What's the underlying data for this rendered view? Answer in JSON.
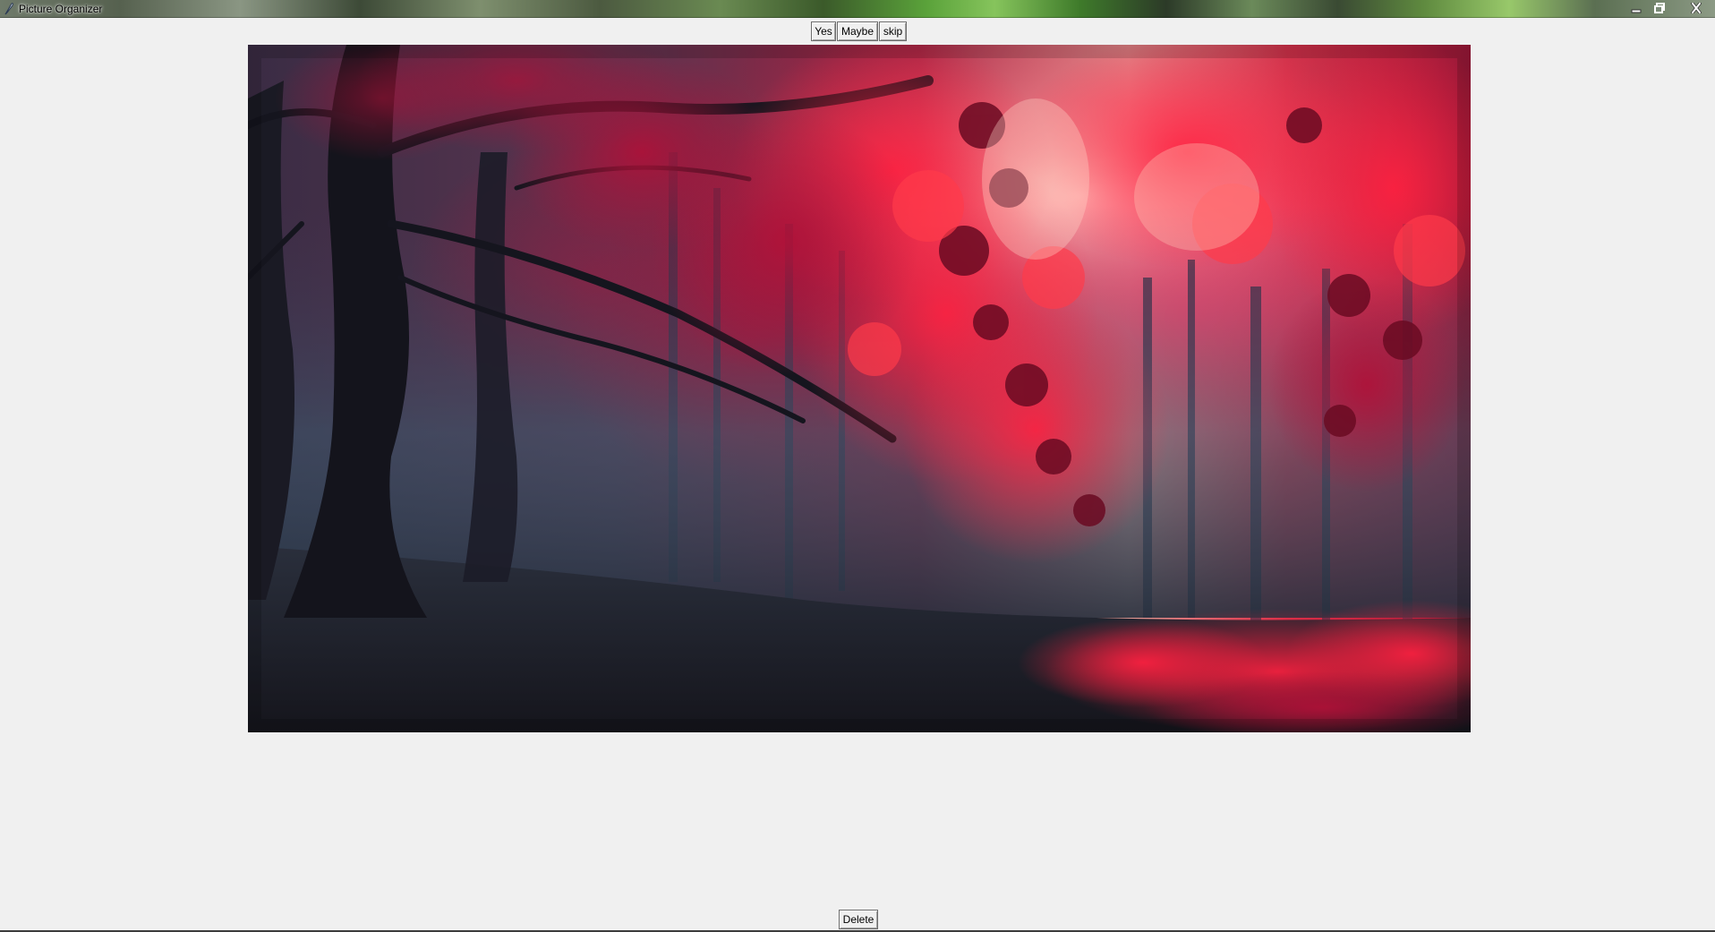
{
  "window": {
    "title": "Picture Organizer"
  },
  "toolbar": {
    "yes_label": "Yes",
    "maybe_label": "Maybe",
    "skip_label": "skip"
  },
  "footer": {
    "delete_label": "Delete"
  },
  "picture": {
    "subject_icon": "image",
    "colors": {
      "foliage_red": "#e0102c",
      "foliage_crimson": "#8a0a2a",
      "trunk_dark": "#16161e",
      "mist_blue": "#3d5a6e",
      "ground_dark": "#1e1e26"
    }
  },
  "icons": {
    "app": "feather-icon",
    "minimize": "minimize-icon",
    "maximize": "restore-icon",
    "close": "close-icon"
  }
}
